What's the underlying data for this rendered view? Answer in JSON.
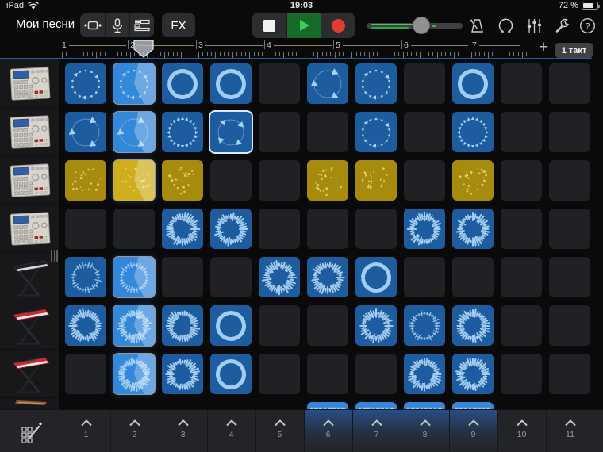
{
  "status_bar": {
    "device": "iPad",
    "time": "19:03",
    "battery": "72 %"
  },
  "toolbar": {
    "my_songs_label": "Мои песни",
    "fx_label": "FX",
    "view_icons": [
      "live-loops-grid-icon",
      "microphone-icon",
      "tracks-view-icon"
    ],
    "transport": [
      "stop-button",
      "play-button",
      "record-button"
    ],
    "right_icons": [
      "metronome-icon",
      "loop-browser-icon",
      "mixer-levels-icon",
      "wrench-icon",
      "help-icon"
    ]
  },
  "ruler": {
    "bars": [
      "1",
      "2",
      "3",
      "4",
      "5",
      "6",
      "7"
    ],
    "playhead_at_bar": 2,
    "add_label": "+",
    "bar_badge": "1 такт"
  },
  "grid": {
    "columns": 11,
    "rows": [
      {
        "instrument": "drum-machine",
        "cells": [
          {
            "col": 1,
            "pattern": "dots"
          },
          {
            "col": 2,
            "pattern": "dots",
            "state": "playing"
          },
          {
            "col": 3,
            "pattern": "ring"
          },
          {
            "col": 4,
            "pattern": "ring"
          },
          {
            "col": 6,
            "pattern": "arrows"
          },
          {
            "col": 7,
            "pattern": "dots"
          },
          {
            "col": 9,
            "pattern": "ring"
          }
        ]
      },
      {
        "instrument": "drum-machine",
        "cells": [
          {
            "col": 1,
            "pattern": "arrows"
          },
          {
            "col": 2,
            "pattern": "arrows",
            "state": "playing"
          },
          {
            "col": 3,
            "pattern": "dense"
          },
          {
            "col": 4,
            "pattern": "arrows4",
            "state": "selected"
          },
          {
            "col": 7,
            "pattern": "dots"
          },
          {
            "col": 9,
            "pattern": "dense"
          }
        ]
      },
      {
        "instrument": "drum-machine",
        "cells": [
          {
            "col": 1,
            "pattern": "scatter"
          },
          {
            "col": 2,
            "pattern": "scatter",
            "state": "playing"
          },
          {
            "col": 3,
            "pattern": "scatter"
          },
          {
            "col": 6,
            "pattern": "scatter"
          },
          {
            "col": 7,
            "pattern": "scatter"
          },
          {
            "col": 9,
            "pattern": "scatter"
          }
        ],
        "color": "yellow"
      },
      {
        "instrument": "drum-machine",
        "cells": [
          {
            "col": 3,
            "pattern": "wave"
          },
          {
            "col": 4,
            "pattern": "wave"
          },
          {
            "col": 8,
            "pattern": "wave"
          },
          {
            "col": 9,
            "pattern": "wave"
          }
        ]
      },
      {
        "instrument": "stage-piano-black",
        "cells": [
          {
            "col": 1,
            "pattern": "wavethin"
          },
          {
            "col": 2,
            "pattern": "wavethin",
            "state": "playing"
          },
          {
            "col": 5,
            "pattern": "wave"
          },
          {
            "col": 6,
            "pattern": "wave"
          },
          {
            "col": 7,
            "pattern": "ring"
          }
        ]
      },
      {
        "instrument": "stage-piano-red",
        "cells": [
          {
            "col": 1,
            "pattern": "wave"
          },
          {
            "col": 2,
            "pattern": "wave",
            "state": "playing"
          },
          {
            "col": 3,
            "pattern": "wave"
          },
          {
            "col": 4,
            "pattern": "ring"
          },
          {
            "col": 7,
            "pattern": "wave"
          },
          {
            "col": 8,
            "pattern": "wavethin"
          },
          {
            "col": 9,
            "pattern": "wave"
          }
        ]
      },
      {
        "instrument": "stage-piano-red",
        "cells": [
          {
            "col": 2,
            "pattern": "wave",
            "state": "playing"
          },
          {
            "col": 3,
            "pattern": "wave"
          },
          {
            "col": 4,
            "pattern": "ring"
          },
          {
            "col": 8,
            "pattern": "wave"
          },
          {
            "col": 9,
            "pattern": "wave"
          }
        ]
      },
      {
        "instrument": "strings-partial",
        "cells": [
          {
            "col": 6,
            "pattern": "wave"
          },
          {
            "col": 7,
            "pattern": "wave"
          },
          {
            "col": 8,
            "pattern": "wave"
          },
          {
            "col": 9,
            "pattern": "wave"
          }
        ],
        "partial": true
      }
    ]
  },
  "bottom_bar": {
    "edit_button": "edit-cells-button",
    "columns": [
      "1",
      "2",
      "3",
      "4",
      "5",
      "6",
      "7",
      "8",
      "9",
      "10",
      "11"
    ],
    "glow_columns": [
      6,
      7,
      8,
      9
    ]
  },
  "colors": {
    "cell_blue": "#1d5c9e",
    "cell_blue_playing": "#3488da",
    "cell_yellow": "#a78b0e",
    "cell_yellow_playing": "#cfae1e",
    "pattern_blue": "#a9d1f5",
    "pattern_yellow": "#f0dc7a",
    "play_green": "#3ecf56",
    "record_red": "#e23b32",
    "selection": "#dce9f9",
    "glow_blue": "#2b70cd"
  }
}
